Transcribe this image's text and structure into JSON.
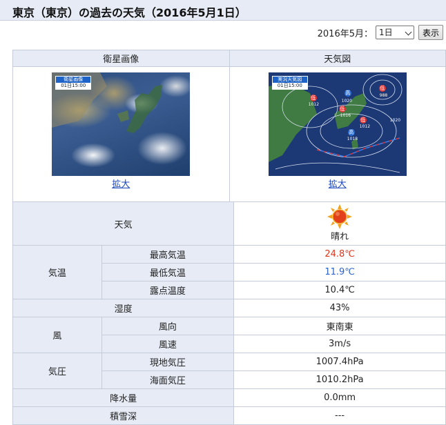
{
  "header": {
    "title": "東京（東京）の過去の天気（2016年5月1日）"
  },
  "date_picker": {
    "label": "2016年5月：",
    "selected_day": "1日",
    "show_button": "表示"
  },
  "images": {
    "satellite": {
      "heading": "衛星画像",
      "badge_title": "衛星画像",
      "badge_time": "01日15:00",
      "zoom_link": "拡大"
    },
    "weather_map": {
      "heading": "天気図",
      "badge_title": "実況天気図",
      "badge_time": "01日15:00",
      "zoom_link": "拡大"
    }
  },
  "weather_map_marks": {
    "low_label": "低",
    "high_label": "高",
    "pressures": [
      "1012",
      "1012",
      "1016",
      "1018",
      "1020",
      "1020",
      "988"
    ]
  },
  "observations": {
    "weather": {
      "label": "天気",
      "value": "晴れ",
      "icon": "sunny-icon"
    },
    "temperature_group": "気温",
    "max_temp": {
      "label": "最高気温",
      "value": "24.8℃"
    },
    "min_temp": {
      "label": "最低気温",
      "value": "11.9℃"
    },
    "dew_point": {
      "label": "露点温度",
      "value": "10.4℃"
    },
    "humidity": {
      "label": "湿度",
      "value": "43%"
    },
    "wind_group": "風",
    "wind_direction": {
      "label": "風向",
      "value": "東南東"
    },
    "wind_speed": {
      "label": "風速",
      "value": "3m/s"
    },
    "pressure_group": "気圧",
    "station_pressure": {
      "label": "現地気圧",
      "value": "1007.4hPa"
    },
    "sea_level_pressure": {
      "label": "海面気圧",
      "value": "1010.2hPa"
    },
    "precipitation": {
      "label": "降水量",
      "value": "0.0mm"
    },
    "snow_depth": {
      "label": "積雪深",
      "value": "---"
    }
  },
  "colors": {
    "header_bg": "#e6ebf5",
    "max_temp": "#e0341b",
    "min_temp": "#2a62c8",
    "link": "#1a46b8"
  }
}
